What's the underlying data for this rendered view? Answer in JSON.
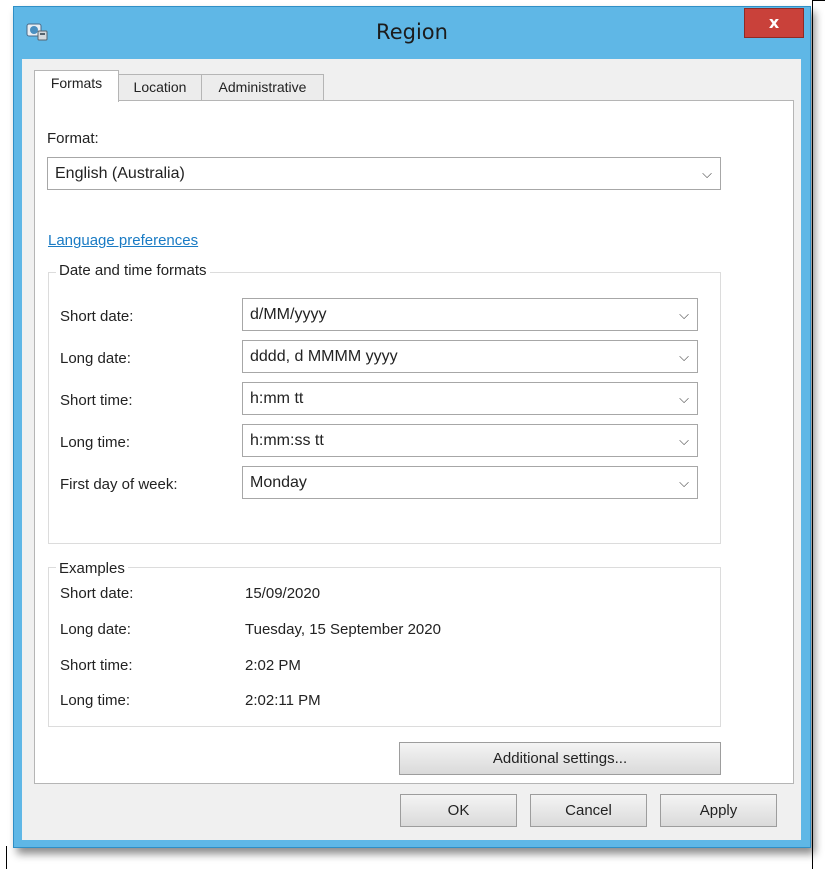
{
  "window": {
    "title": "Region",
    "close_label": "x"
  },
  "tabs": [
    {
      "label": "Formats",
      "active": true
    },
    {
      "label": "Location",
      "active": false
    },
    {
      "label": "Administrative",
      "active": false
    }
  ],
  "format": {
    "label": "Format:",
    "value": "English (Australia)"
  },
  "language_preferences_link": "Language preferences",
  "date_time_formats": {
    "title": "Date and time formats",
    "rows": [
      {
        "label": "Short date:",
        "value": "d/MM/yyyy"
      },
      {
        "label": "Long date:",
        "value": "dddd, d MMMM yyyy"
      },
      {
        "label": "Short time:",
        "value": "h:mm tt"
      },
      {
        "label": "Long time:",
        "value": "h:mm:ss tt"
      },
      {
        "label": "First day of week:",
        "value": "Monday"
      }
    ]
  },
  "examples": {
    "title": "Examples",
    "rows": [
      {
        "label": "Short date:",
        "value": "15/09/2020"
      },
      {
        "label": "Long date:",
        "value": "Tuesday, 15 September 2020"
      },
      {
        "label": "Short time:",
        "value": "2:02 PM"
      },
      {
        "label": "Long time:",
        "value": "2:02:11 PM"
      }
    ]
  },
  "buttons": {
    "additional_settings": "Additional settings...",
    "ok": "OK",
    "cancel": "Cancel",
    "apply": "Apply"
  },
  "icons": {
    "app": "region-globe-icon",
    "dropdown": "chevron-down-icon"
  },
  "colors": {
    "titlebar": "#5fb7e6",
    "close_button": "#c9413a",
    "link": "#1a7bc4"
  }
}
